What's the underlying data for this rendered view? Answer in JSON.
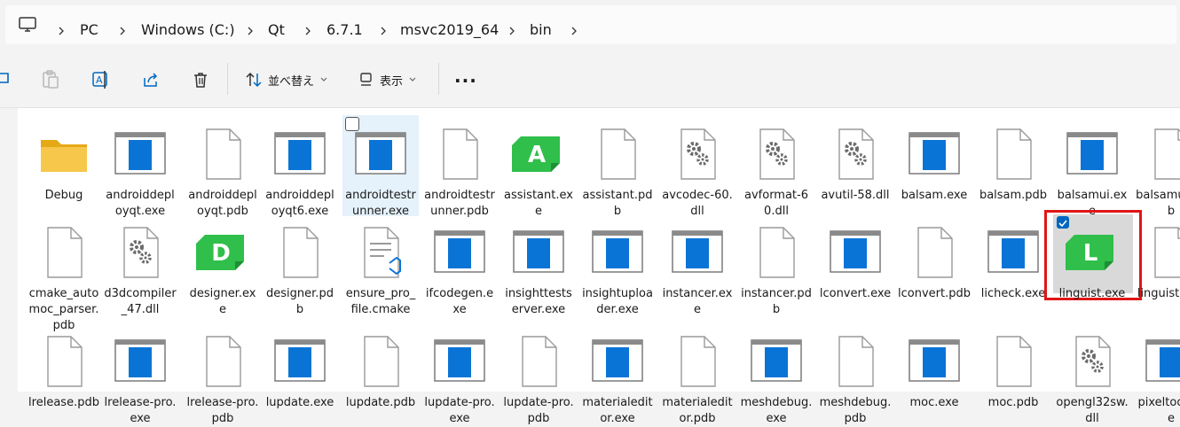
{
  "address_bar": {
    "crumbs": [
      "PC",
      "Windows (C:)",
      "Qt",
      "6.7.1",
      "msvc2019_64",
      "bin"
    ]
  },
  "toolbar": {
    "sort_label": "並べ替え",
    "view_label": "表示",
    "more_label": "..."
  },
  "files": [
    {
      "name": "Debug",
      "icon": "folder"
    },
    {
      "name": "androiddeployqt.exe",
      "icon": "exe"
    },
    {
      "name": "androiddeployqt.pdb",
      "icon": "doc"
    },
    {
      "name": "androiddeployqt6.exe",
      "icon": "exe"
    },
    {
      "name": "androidtestrunner.exe",
      "icon": "exe",
      "hover": true
    },
    {
      "name": "androidtestrunner.pdb",
      "icon": "doc"
    },
    {
      "name": "assistant.exe",
      "icon": "app",
      "letter": "A"
    },
    {
      "name": "assistant.pdb",
      "icon": "doc"
    },
    {
      "name": "avcodec-60.dll",
      "icon": "dll"
    },
    {
      "name": "avformat-60.dll",
      "icon": "dll"
    },
    {
      "name": "avutil-58.dll",
      "icon": "dll"
    },
    {
      "name": "balsam.exe",
      "icon": "exe"
    },
    {
      "name": "balsam.pdb",
      "icon": "doc"
    },
    {
      "name": "balsamui.exe",
      "icon": "exe"
    },
    {
      "name": "balsamui.pdb",
      "icon": "doc"
    },
    {
      "name": "cmake_automoc_parser.pdb",
      "icon": "doc"
    },
    {
      "name": "d3dcompiler_47.dll",
      "icon": "dll"
    },
    {
      "name": "designer.exe",
      "icon": "app",
      "letter": "D"
    },
    {
      "name": "designer.pdb",
      "icon": "doc"
    },
    {
      "name": "ensure_pro_file.cmake",
      "icon": "cmake"
    },
    {
      "name": "ifcodegen.exe",
      "icon": "exe"
    },
    {
      "name": "insighttestserver.exe",
      "icon": "exe"
    },
    {
      "name": "insightuploader.exe",
      "icon": "exe"
    },
    {
      "name": "instancer.exe",
      "icon": "exe"
    },
    {
      "name": "instancer.pdb",
      "icon": "doc"
    },
    {
      "name": "lconvert.exe",
      "icon": "exe"
    },
    {
      "name": "lconvert.pdb",
      "icon": "doc"
    },
    {
      "name": "licheck.exe",
      "icon": "exe"
    },
    {
      "name": "linguist.exe",
      "icon": "app",
      "letter": "L",
      "selected": true
    },
    {
      "name": "linguist.pdb",
      "icon": "doc"
    },
    {
      "name": "lrelease.pdb",
      "icon": "doc"
    },
    {
      "name": "lrelease-pro.exe",
      "icon": "exe"
    },
    {
      "name": "lrelease-pro.pdb",
      "icon": "doc"
    },
    {
      "name": "lupdate.exe",
      "icon": "exe"
    },
    {
      "name": "lupdate.pdb",
      "icon": "doc"
    },
    {
      "name": "lupdate-pro.exe",
      "icon": "exe"
    },
    {
      "name": "lupdate-pro.pdb",
      "icon": "doc"
    },
    {
      "name": "materialeditor.exe",
      "icon": "exe"
    },
    {
      "name": "materialeditor.pdb",
      "icon": "doc"
    },
    {
      "name": "meshdebug.exe",
      "icon": "exe"
    },
    {
      "name": "meshdebug.pdb",
      "icon": "doc"
    },
    {
      "name": "moc.exe",
      "icon": "exe"
    },
    {
      "name": "moc.pdb",
      "icon": "doc"
    },
    {
      "name": "opengl32sw.dll",
      "icon": "dll"
    },
    {
      "name": "pixeltool.exe",
      "icon": "exe"
    }
  ],
  "colors": {
    "accent": "#0067c0",
    "qt_green": "#2fbf4a",
    "selection_box": "#e01616"
  }
}
